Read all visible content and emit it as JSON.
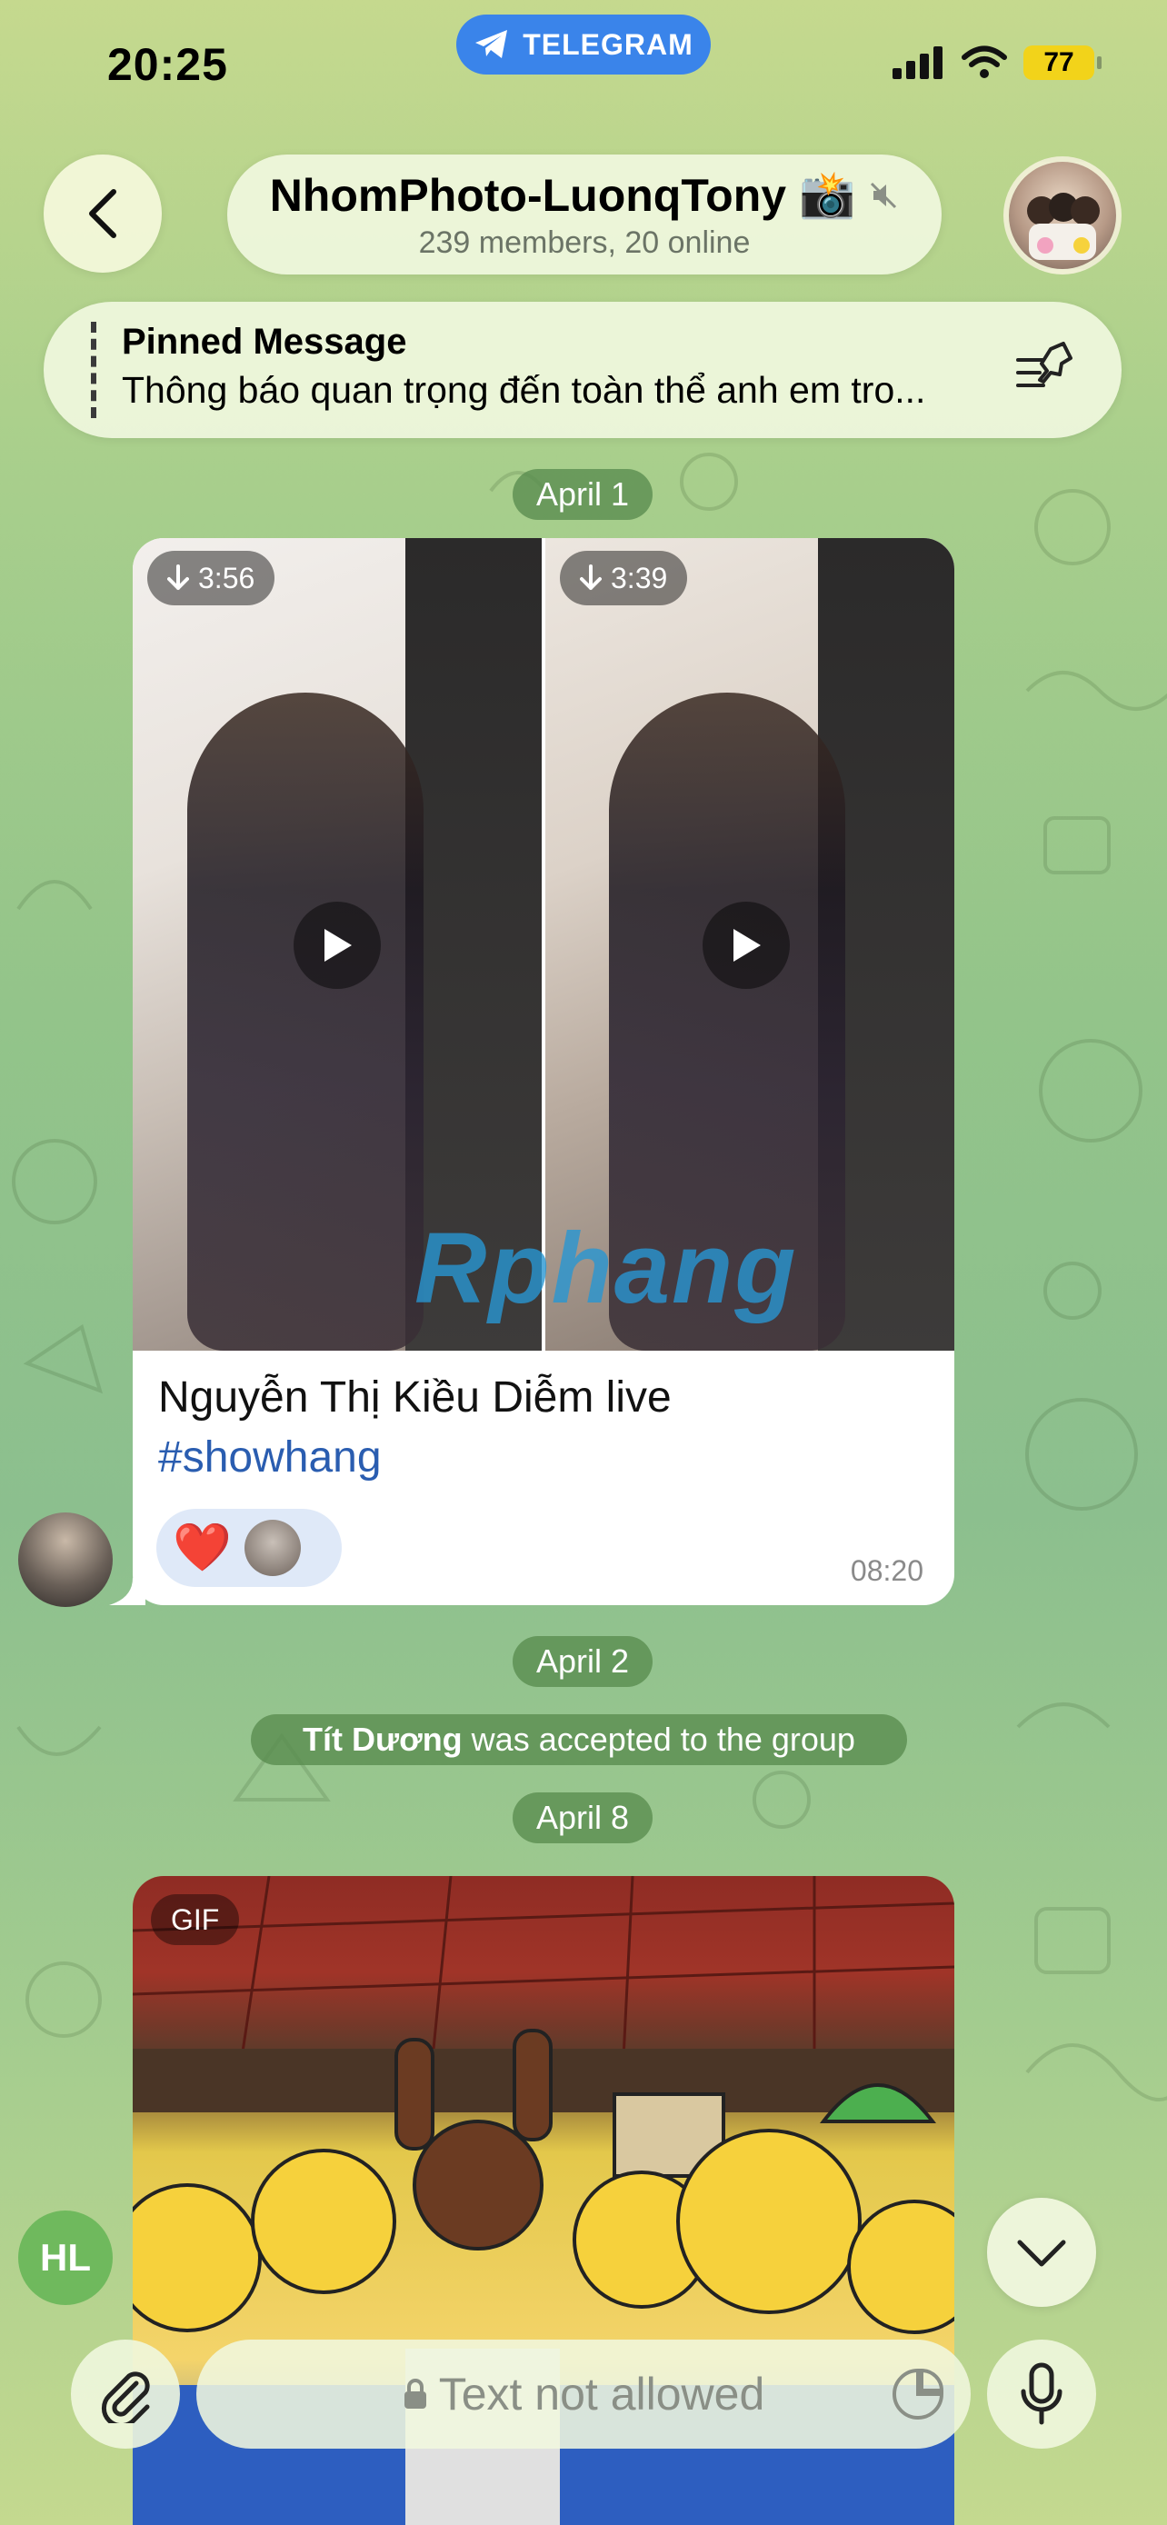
{
  "status_bar": {
    "time": "20:25",
    "pill_label": "TELEGRAM",
    "battery": "77"
  },
  "header": {
    "title": "NhomPhoto-LuonqTony",
    "title_emoji": "📸",
    "subtitle": "239 members, 20 online"
  },
  "pinned": {
    "title": "Pinned Message",
    "text": "Thông báo quan trọng đến toàn thể anh em tro..."
  },
  "dates": {
    "d1": "April 1",
    "d2": "April 2",
    "d3": "April 8"
  },
  "message1": {
    "video1_duration": "3:56",
    "video2_duration": "3:39",
    "watermark": "Rphang",
    "caption": "Nguyễn Thị Kiều Diễm live",
    "hashtag": "#showhang",
    "reaction_emoji": "❤️",
    "time": "08:20"
  },
  "service_message": {
    "name": "Tít Dương",
    "text": "was accepted to the group"
  },
  "message2": {
    "badge": "GIF"
  },
  "bottom": {
    "avatar_initials": "HL",
    "input_placeholder": "Text not allowed"
  },
  "colors": {
    "accent": "#3a84ea",
    "link": "#2a5db0",
    "date_pill": "#588c4e",
    "reaction_bg": "#dfe9f8",
    "hl_avatar": "#6fb95d"
  }
}
